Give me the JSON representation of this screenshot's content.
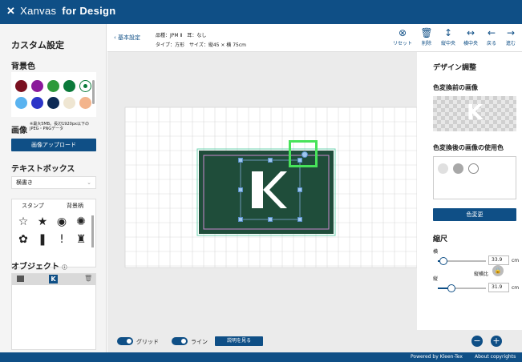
{
  "app": {
    "logo_name": "Xanvas",
    "logo_suffix": "for Design"
  },
  "sidebar": {
    "title": "カスタム設定",
    "bg_color_label": "背景色",
    "colors": [
      "#7a1020",
      "#8a1a9a",
      "#2e9a3a",
      "#0b7a3a",
      "#ffffff",
      "#5ab3f0",
      "#2c35c8",
      "#0d2a55",
      "#efe6d2",
      "#f3b48c"
    ],
    "image_label": "画像",
    "image_note": "※最大5MB。長辺1920px以下のJPEG・PNGデータ",
    "upload_button": "画像アップロード",
    "textbox_label": "テキストボックス",
    "text_direction": "横書き",
    "tab_stamp": "スタンプ",
    "tab_pattern": "背景柄",
    "object_label": "オブジェクト",
    "object_icon": "K"
  },
  "header": {
    "back_label": "基本設定",
    "line1": "品種：JPM Ⅱ　耳：なし",
    "line2": "タイプ：方形　サイズ：縦45 × 横 75cm",
    "tools": [
      {
        "label": "リセット",
        "icon": "⊗"
      },
      {
        "label": "削除",
        "icon": "🗑"
      },
      {
        "label": "縦中央",
        "icon": "↕"
      },
      {
        "label": "横中央",
        "icon": "↔"
      },
      {
        "label": "戻る",
        "icon": "←"
      },
      {
        "label": "進む",
        "icon": "→"
      }
    ]
  },
  "design_panel": {
    "title": "デザイン調整",
    "before_label": "色変換前の画像",
    "after_label": "色変換後の画像の使用色",
    "used_colors": [
      "#e0e0e0",
      "#a8a8a8",
      "#ffffff"
    ],
    "change_color_button": "色変更",
    "scale_label": "縮尺",
    "width_label": "横",
    "width_value": "33.9",
    "height_label": "縦",
    "height_value": "31.9",
    "unit": "cm",
    "ratio_label": "縦横比",
    "width_fill": 0.12,
    "height_fill": 0.28
  },
  "canvas": {
    "mat_color": "#1f4d3a",
    "logo_letter": "K"
  },
  "bottombar": {
    "grid_label": "グリッド",
    "line_label": "ライン",
    "help_button": "説明を見る"
  },
  "footer": {
    "powered": "Powered by Kleen-Tex",
    "about": "About copyrights"
  }
}
